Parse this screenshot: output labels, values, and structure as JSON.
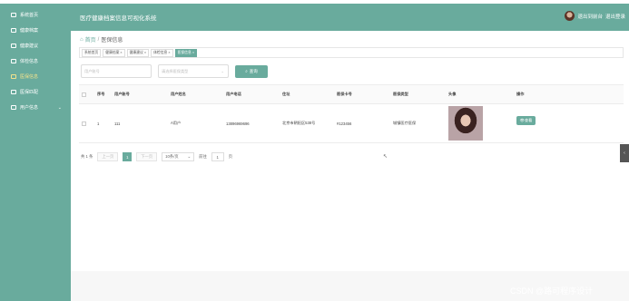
{
  "header": {
    "app_title": "医疗健康档案信息可视化系统",
    "user_label": "退出到前台",
    "logout_label": "退出登录"
  },
  "sidebar": {
    "items": [
      {
        "label": "系统首页",
        "active": false,
        "icon": "home-icon"
      },
      {
        "label": "健康档案",
        "active": false,
        "icon": "folder-icon"
      },
      {
        "label": "健康建议",
        "active": false,
        "icon": "advice-icon"
      },
      {
        "label": "体检信息",
        "active": false,
        "icon": "checkup-icon"
      },
      {
        "label": "医保信息",
        "active": true,
        "icon": "insurance-icon"
      },
      {
        "label": "医保匹配",
        "active": false,
        "icon": "match-icon"
      },
      {
        "label": "用户信息",
        "active": false,
        "icon": "user-icon",
        "has_children": true
      }
    ]
  },
  "breadcrumb": {
    "home": "首页",
    "separator": "/",
    "current": "医保信息"
  },
  "tags": [
    {
      "label": "系统首页",
      "active": false
    },
    {
      "label": "健康档案 ×",
      "active": false
    },
    {
      "label": "健康建议 ×",
      "active": false
    },
    {
      "label": "体检信息 ×",
      "active": false
    },
    {
      "label": "医保信息 ×",
      "active": true
    }
  ],
  "filters": {
    "account_placeholder": "用户账号",
    "type_placeholder": "请选择医保类型",
    "search_label": "查询"
  },
  "table": {
    "headers": [
      "序号",
      "用户账号",
      "用户姓名",
      "用户电话",
      "住址",
      "医保卡号",
      "医保类型",
      "头像",
      "操作"
    ],
    "rows": [
      {
        "index": "1",
        "account": "111",
        "name": "A用户",
        "phone": "13896969696",
        "address": "北京市朝阳区538号",
        "card_no": "#123456",
        "type": "城镇医疗医保",
        "view_label": "查看"
      }
    ]
  },
  "pager": {
    "total": "共 1 条",
    "prev": "上一页",
    "page": "1",
    "next": "下一页",
    "page_size": "10条/页",
    "goto_prefix": "前往",
    "goto_value": "1",
    "goto_suffix": "页"
  },
  "watermark": "CSDN @路可程序设计",
  "colors": {
    "accent": "#69ab9d",
    "active_menu": "#f2e28c"
  }
}
